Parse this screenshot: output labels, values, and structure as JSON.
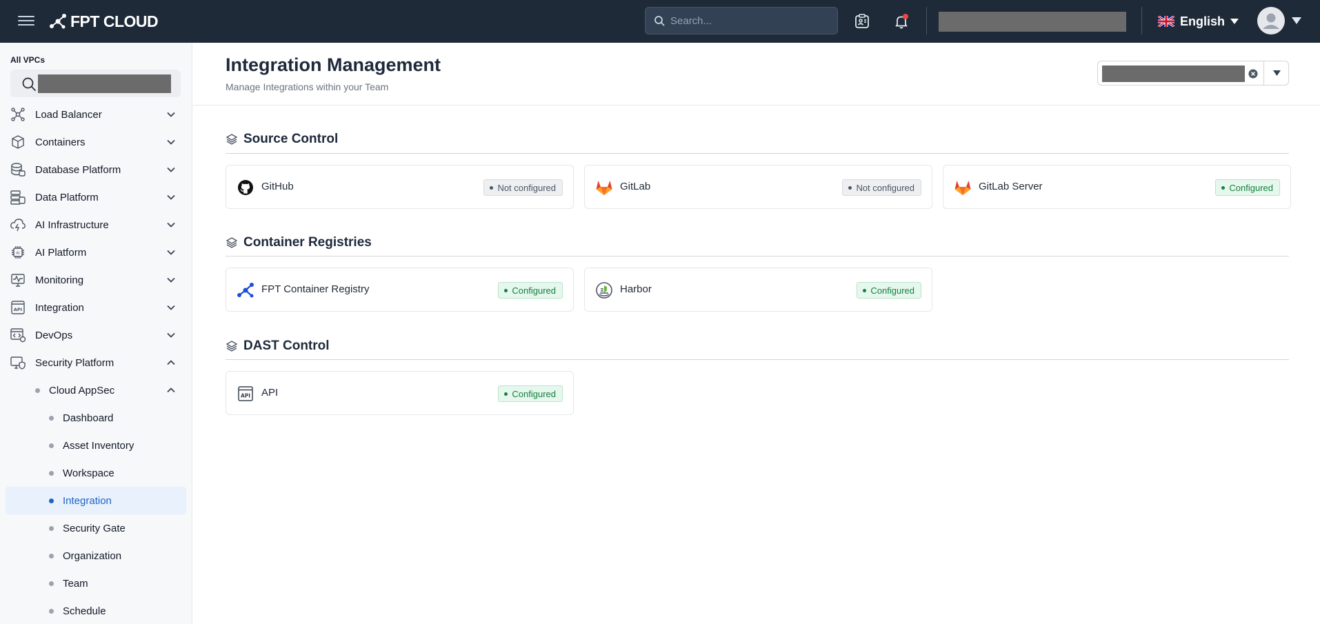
{
  "header": {
    "logo_text": "FPT CLOUD",
    "search_placeholder": "Search...",
    "language": "English"
  },
  "sidebar": {
    "vpc_label": "All VPCs",
    "items": [
      {
        "label": "Load Balancer",
        "icon": "network-nodes-icon",
        "expanded": false
      },
      {
        "label": "Containers",
        "icon": "cube-icon",
        "expanded": false
      },
      {
        "label": "Database Platform",
        "icon": "database-icon",
        "expanded": false
      },
      {
        "label": "Data Platform",
        "icon": "data-stack-icon",
        "expanded": false
      },
      {
        "label": "AI Infrastructure",
        "icon": "cloud-bolt-icon",
        "expanded": false
      },
      {
        "label": "AI Platform",
        "icon": "chip-icon",
        "expanded": false
      },
      {
        "label": "Monitoring",
        "icon": "monitor-pulse-icon",
        "expanded": false
      },
      {
        "label": "Integration",
        "icon": "api-icon",
        "expanded": false
      },
      {
        "label": "DevOps",
        "icon": "code-window-icon",
        "expanded": false
      },
      {
        "label": "Security Platform",
        "icon": "security-screen-icon",
        "expanded": true
      }
    ],
    "cloud_appsec": "Cloud AppSec",
    "sub_items": [
      {
        "label": "Dashboard",
        "active": false
      },
      {
        "label": "Asset Inventory",
        "active": false
      },
      {
        "label": "Workspace",
        "active": false
      },
      {
        "label": "Integration",
        "active": true
      },
      {
        "label": "Security Gate",
        "active": false
      },
      {
        "label": "Organization",
        "active": false
      },
      {
        "label": "Team",
        "active": false
      },
      {
        "label": "Schedule",
        "active": false
      }
    ]
  },
  "main": {
    "title": "Integration Management",
    "subtitle": "Manage Integrations within your Team",
    "sections": [
      {
        "title": "Source Control",
        "cards": [
          {
            "name": "GitHub",
            "icon": "github-icon",
            "status": "Not configured",
            "configured": false
          },
          {
            "name": "GitLab",
            "icon": "gitlab-icon",
            "status": "Not configured",
            "configured": false
          },
          {
            "name": "GitLab Server",
            "icon": "gitlab-server-icon",
            "status": "Configured",
            "configured": true
          }
        ]
      },
      {
        "title": "Container Registries",
        "cards": [
          {
            "name": "FPT Container Registry",
            "icon": "fpt-registry-icon",
            "status": "Configured",
            "configured": true
          },
          {
            "name": "Harbor",
            "icon": "harbor-icon",
            "status": "Configured",
            "configured": true
          }
        ]
      },
      {
        "title": "DAST Control",
        "cards": [
          {
            "name": "API",
            "icon": "api-icon",
            "status": "Configured",
            "configured": true
          }
        ]
      }
    ]
  },
  "colors": {
    "topbar": "#1e2a38",
    "accent": "#1d63c8",
    "configured": "#15803d",
    "not_configured": "#4b5563"
  }
}
